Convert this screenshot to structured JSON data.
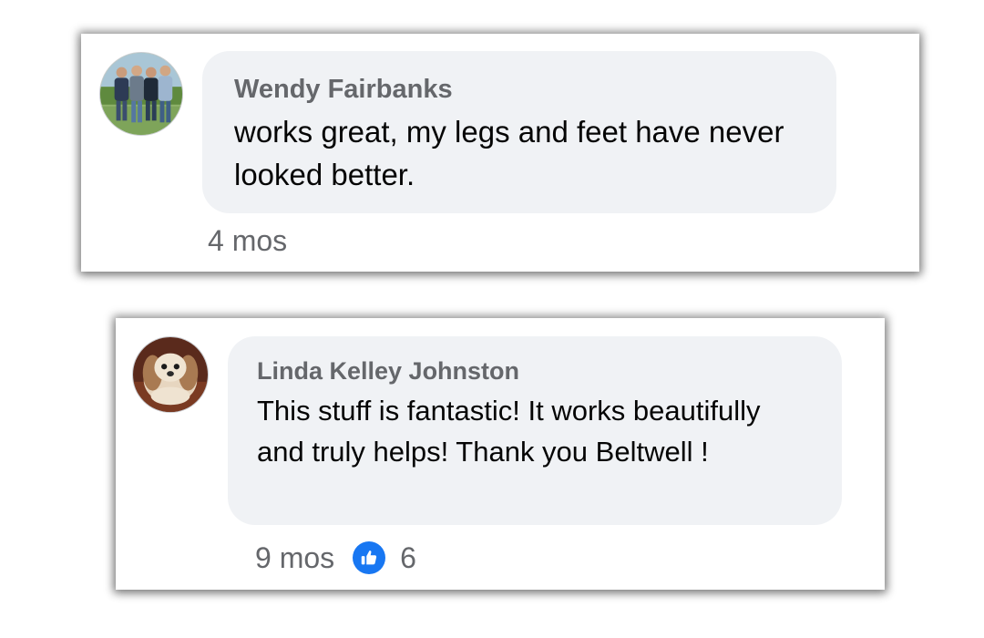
{
  "comments": [
    {
      "author": "Wendy Fairbanks",
      "text": "works great, my legs and feet have never looked better.",
      "time": "4 mos"
    },
    {
      "author": "Linda Kelley Johnston",
      "text": "This stuff is fantastic! It works beautifully and truly helps! Thank you Beltwell !",
      "time": "9 mos",
      "reaction_icon": "like-icon",
      "reaction_count": "6"
    }
  ],
  "colors": {
    "bubble_bg": "#f0f2f5",
    "author": "#65676b",
    "text": "#050505",
    "meta": "#65676b",
    "like_blue": "#1877f2"
  }
}
